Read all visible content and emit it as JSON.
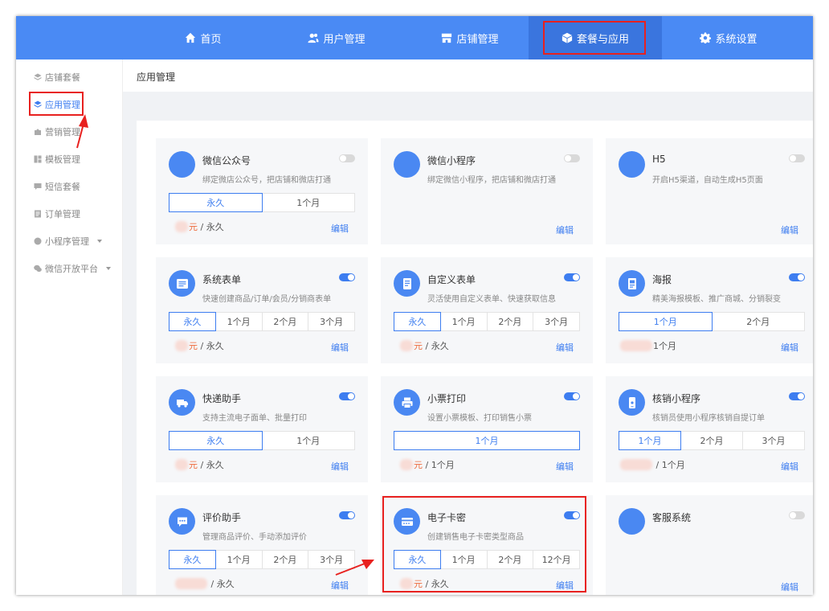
{
  "nav": {
    "items": [
      {
        "label": "首页",
        "icon": "home-icon"
      },
      {
        "label": "用户管理",
        "icon": "users-icon"
      },
      {
        "label": "店铺管理",
        "icon": "store-icon"
      },
      {
        "label": "套餐与应用",
        "icon": "cube-icon",
        "active": true
      },
      {
        "label": "系统设置",
        "icon": "gear-icon"
      }
    ]
  },
  "sidebar": {
    "items": [
      {
        "label": "店铺套餐",
        "icon": "layers-icon"
      },
      {
        "label": "应用管理",
        "icon": "layers-icon",
        "active": true
      },
      {
        "label": "营销管理",
        "icon": "puzzle-icon"
      },
      {
        "label": "模板管理",
        "icon": "grid-icon"
      },
      {
        "label": "短信套餐",
        "icon": "message-icon"
      },
      {
        "label": "订单管理",
        "icon": "list-icon"
      },
      {
        "label": "小程序管理",
        "icon": "circle-icon",
        "expandable": true
      },
      {
        "label": "微信开放平台",
        "icon": "wechat-icon",
        "expandable": true
      }
    ]
  },
  "page": {
    "title": "应用管理"
  },
  "common": {
    "edit": "编辑",
    "yuan": "元",
    "sep": " / "
  },
  "cards": [
    {
      "name": "微信公众号",
      "desc": "绑定微店公众号，把店铺和微店打通",
      "on": false,
      "periods": [
        "永久",
        "1个月"
      ],
      "selected": 0,
      "price_unit": "永久"
    },
    {
      "name": "微信小程序",
      "desc": "绑定微信小程序，把店铺和微店打通",
      "on": false,
      "periods": [],
      "selected": -1,
      "price_unit": ""
    },
    {
      "name": "H5",
      "desc": "开启H5渠道，自动生成H5页面",
      "on": false,
      "periods": [],
      "selected": -1,
      "price_unit": ""
    },
    {
      "name": "系统表单",
      "desc": "快速创建商品/订单/会员/分销商表单",
      "on": true,
      "periods": [
        "永久",
        "1个月",
        "2个月",
        "3个月"
      ],
      "selected": 0,
      "price_unit": "永久"
    },
    {
      "name": "自定义表单",
      "desc": "灵活使用自定义表单、快速获取信息",
      "on": true,
      "periods": [
        "永久",
        "1个月",
        "2个月",
        "3个月"
      ],
      "selected": 0,
      "price_unit": "永久"
    },
    {
      "name": "海报",
      "desc": "精美海报模板、推广商城、分销裂变",
      "on": true,
      "periods": [
        "1个月",
        "2个月"
      ],
      "selected": 0,
      "price_unit": "1个月"
    },
    {
      "name": "快递助手",
      "desc": "支持主流电子面单、批量打印",
      "on": true,
      "periods": [
        "永久",
        "1个月"
      ],
      "selected": 0,
      "price_unit": "永久"
    },
    {
      "name": "小票打印",
      "desc": "设置小票模板、打印销售小票",
      "on": true,
      "periods": [
        "1个月"
      ],
      "selected": 0,
      "price_unit": "1个月"
    },
    {
      "name": "核销小程序",
      "desc": "核销员使用小程序核销自提订单",
      "on": true,
      "periods": [
        "1个月",
        "2个月",
        "3个月"
      ],
      "selected": 0,
      "price_unit": "1个月"
    },
    {
      "name": "评价助手",
      "desc": "管理商品评价、手动添加评价",
      "on": true,
      "periods": [
        "永久",
        "1个月",
        "2个月",
        "3个月"
      ],
      "selected": 0,
      "price_unit": "永久"
    },
    {
      "name": "电子卡密",
      "desc": "创建销售电子卡密类型商品",
      "on": true,
      "periods": [
        "永久",
        "1个月",
        "2个月",
        "12个月"
      ],
      "selected": 0,
      "price_unit": "永久"
    },
    {
      "name": "客服系统",
      "desc": "",
      "on": false,
      "periods": [],
      "selected": -1,
      "price_unit": ""
    }
  ]
}
